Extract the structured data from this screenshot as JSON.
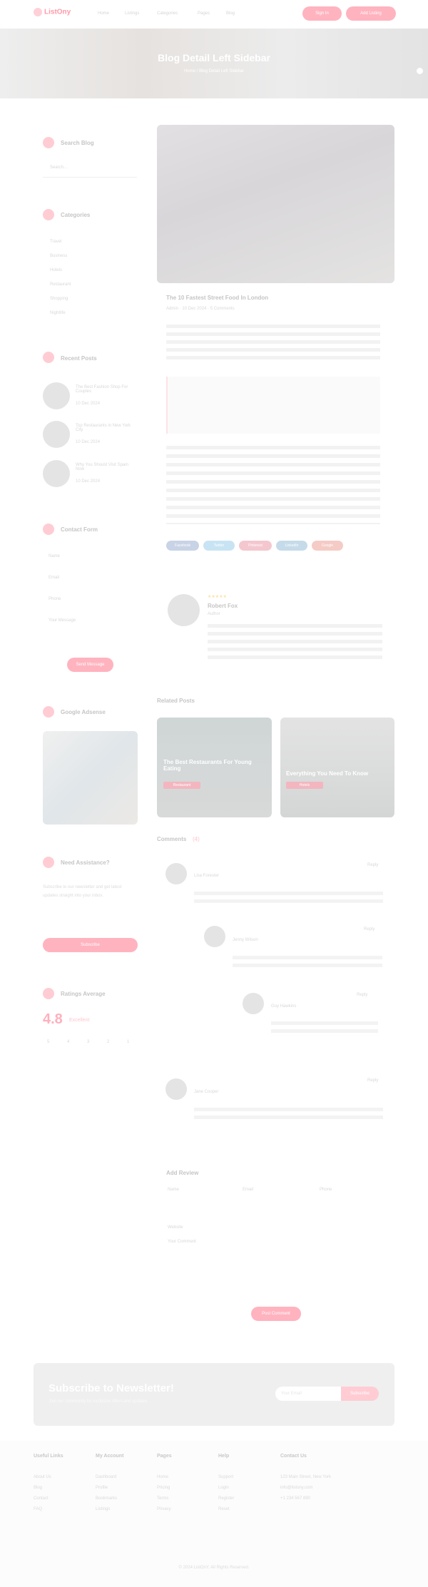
{
  "header": {
    "logo": "ListOny",
    "nav": [
      "Home",
      "Listings",
      "Categories",
      "Pages",
      "Blog"
    ],
    "btn_signin": "Sign In",
    "btn_add": "Add Listing"
  },
  "hero": {
    "title": "Blog Detail Left Sidebar",
    "breadcrumb": "Home / Blog Detail Left Sidebar"
  },
  "sidebar": {
    "search": {
      "title": "Search Blog",
      "placeholder": "Search..."
    },
    "categories": {
      "title": "Categories",
      "items": [
        "Travel",
        "Business",
        "Hotels",
        "Restaurant",
        "Shopping",
        "Nightlife"
      ]
    },
    "recent": {
      "title": "Recent Posts",
      "posts": [
        {
          "title": "The Best Fashion Shop For Couples",
          "date": "10 Dec 2024"
        },
        {
          "title": "Top Restaurants in New York City",
          "date": "10 Dec 2024"
        },
        {
          "title": "Why You Should Visit Spain Now",
          "date": "10 Dec 2024"
        }
      ]
    },
    "contact": {
      "title": "Contact Form",
      "fields": [
        "Name",
        "Email",
        "Phone",
        "Your Message"
      ],
      "button": "Send Message"
    },
    "gallery": {
      "title": "Google Adsense"
    },
    "newsletter": {
      "title": "Need Assistance?",
      "text": "Subscribe to our newsletter and get latest updates straight into your inbox.",
      "button": "Subscribe"
    },
    "rating": {
      "title": "Ratings Average",
      "score": "4.8",
      "label": "Excellent",
      "bars": [
        "5",
        "4",
        "3",
        "2",
        "1"
      ]
    }
  },
  "post": {
    "title": "The 10 Fastest Street Food In London",
    "meta": "Admin · 10 Dec 2024 · 5 Comments",
    "tags": [
      "Facebook",
      "Twitter",
      "Pinterest",
      "LinkedIn",
      "Google"
    ]
  },
  "author": {
    "name": "Robert Fox",
    "role": "Author",
    "stars": "★★★★★"
  },
  "related": {
    "title": "Related Posts",
    "cards": [
      {
        "title": "The Best Restaurants For Young Eating",
        "tag": "Restaurant"
      },
      {
        "title": "Everything You Need To Know",
        "tag": "Hotels"
      }
    ]
  },
  "comments": {
    "title": "Comments",
    "count": "(4)",
    "items": [
      {
        "name": "Lisa Forester",
        "reply": "Reply"
      },
      {
        "name": "Jenny Wilson",
        "reply": "Reply"
      },
      {
        "name": "Guy Hawkins",
        "reply": "Reply"
      },
      {
        "name": "Jane Cooper",
        "reply": "Reply"
      }
    ]
  },
  "reply": {
    "title": "Add Review",
    "fields": [
      "Name",
      "Email",
      "Phone",
      "Website",
      "Your Comment"
    ],
    "button": "Post Comment"
  },
  "subscribe": {
    "title": "Subscribe to Newsletter!",
    "sub": "Join our community for exclusive offers and updates.",
    "placeholder": "Your Email",
    "button": "Subscribe"
  },
  "footer": {
    "cols": [
      {
        "title": "Useful Links",
        "items": [
          "About Us",
          "Blog",
          "Contact",
          "FAQ"
        ]
      },
      {
        "title": "My Account",
        "items": [
          "Dashboard",
          "Profile",
          "Bookmarks",
          "Listings"
        ]
      },
      {
        "title": "Pages",
        "items": [
          "Home",
          "Pricing",
          "Terms",
          "Privacy"
        ]
      },
      {
        "title": "Help",
        "items": [
          "Support",
          "Login",
          "Register",
          "Reset"
        ]
      },
      {
        "title": "Contact Us",
        "items": [
          "123 Main Street, New York",
          "info@listony.com",
          "+1 234 567 890"
        ]
      }
    ],
    "copyright": "© 2024 ListOnY. All Rights Reserved."
  }
}
